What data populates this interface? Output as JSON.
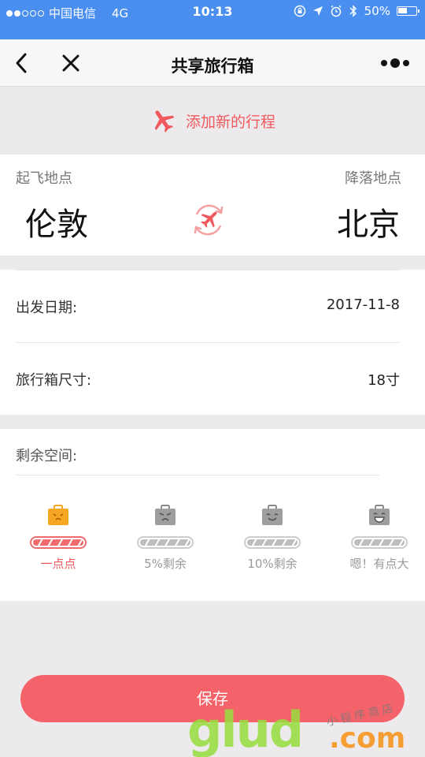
{
  "status_bar": {
    "carrier": "中国电信",
    "network": "4G",
    "time": "10:13",
    "battery": "50%",
    "battery_fraction": 0.5
  },
  "navbar": {
    "title": "共享旅行箱",
    "back_icon": "chevron-left-icon",
    "close_icon": "close-icon",
    "more_icon": "more-dots-icon"
  },
  "add_trip": {
    "label": "添加新的行程",
    "icon": "airplane-icon",
    "color": "#f05a5e"
  },
  "route": {
    "from_label": "起飞地点",
    "from_city": "伦敦",
    "to_label": "降落地点",
    "to_city": "北京",
    "swap_icon": "swap-flight-icon"
  },
  "info": {
    "date_label": "出发日期:",
    "date_value": "2017-11-8",
    "size_label": "旅行箱尺寸:",
    "size_value": "18寸"
  },
  "space": {
    "title": "剩余空间:",
    "options": [
      {
        "label": "一点点",
        "icon": "suitcase-tiny-icon",
        "selected": true
      },
      {
        "label": "5%剩余",
        "icon": "suitcase-sad-icon",
        "selected": false
      },
      {
        "label": "10%剩余",
        "icon": "suitcase-smile-icon",
        "selected": false
      },
      {
        "label": "嗯！有点大",
        "icon": "suitcase-grin-icon",
        "selected": false
      }
    ]
  },
  "save_button": {
    "label": "保存",
    "color": "#f5636a"
  },
  "watermark": {
    "text": "glud",
    "suffix": ".com",
    "tagline": "小程序商店"
  },
  "colors": {
    "header_blue": "#4a8ef0",
    "accent_red": "#f05a5e",
    "background": "#eceaed"
  }
}
